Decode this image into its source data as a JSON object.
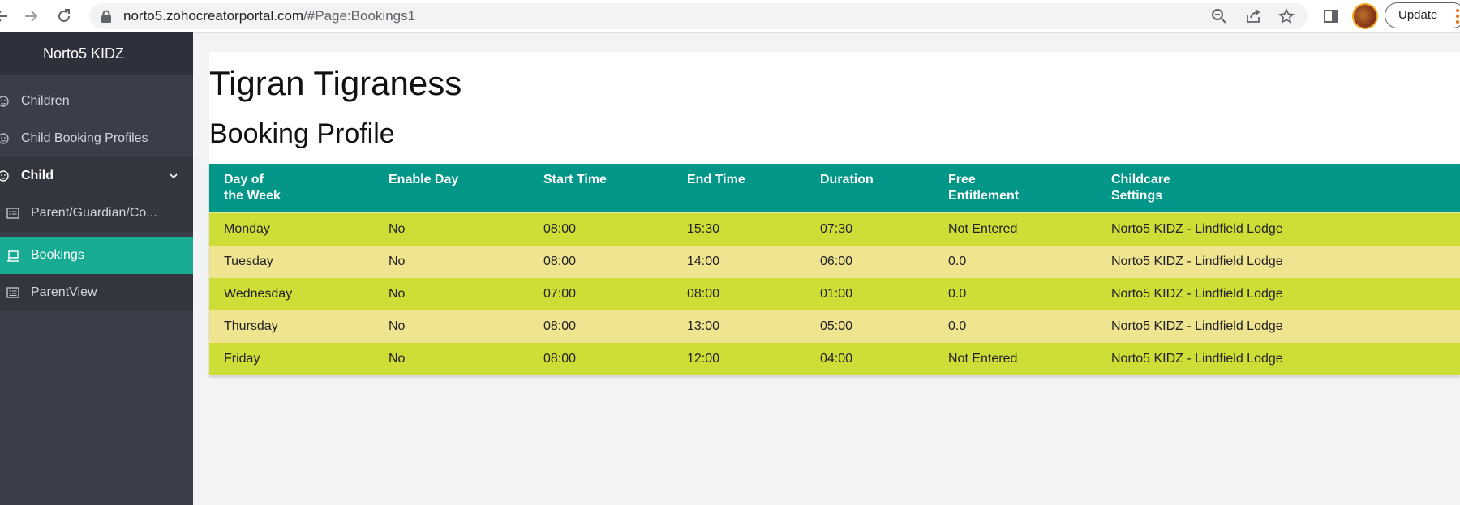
{
  "browser": {
    "url_host": "norto5.zohocreatorportal.com",
    "url_path": "/#Page:Bookings1",
    "update_label": "Update"
  },
  "sidebar": {
    "app_title": "Norto5 KIDZ",
    "items": [
      {
        "label": "Children",
        "icon": "child-face-icon"
      },
      {
        "label": "Child Booking Profiles",
        "icon": "child-face-icon"
      },
      {
        "label": "Child",
        "icon": "child-face-icon",
        "expanded": true
      },
      {
        "label": "Parent/Guardian/Co...",
        "icon": "form-list-icon"
      },
      {
        "label": "Bookings",
        "icon": "booking-page-icon",
        "active": true
      },
      {
        "label": "ParentView",
        "icon": "form-list-icon"
      }
    ]
  },
  "main": {
    "person_name": "Tigran Tigraness",
    "section_title": "Booking Profile",
    "table": {
      "columns": [
        [
          "Day of",
          "the Week"
        ],
        [
          "Enable Day"
        ],
        [
          "Start Time"
        ],
        [
          "End Time"
        ],
        [
          "Duration"
        ],
        [
          "Free",
          "Entitlement"
        ],
        [
          "Childcare",
          "Settings"
        ]
      ],
      "rows": [
        [
          "Monday",
          "No",
          "08:00",
          "15:30",
          "07:30",
          "Not Entered",
          "Norto5 KIDZ - Lindfield Lodge"
        ],
        [
          "Tuesday",
          "No",
          "08:00",
          "14:00",
          "06:00",
          "0.0",
          "Norto5 KIDZ - Lindfield Lodge"
        ],
        [
          "Wednesday",
          "No",
          "07:00",
          "08:00",
          "01:00",
          "0.0",
          "Norto5 KIDZ - Lindfield Lodge"
        ],
        [
          "Thursday",
          "No",
          "08:00",
          "13:00",
          "05:00",
          "0.0",
          "Norto5 KIDZ - Lindfield Lodge"
        ],
        [
          "Friday",
          "No",
          "08:00",
          "12:00",
          "04:00",
          "Not Entered",
          "Norto5 KIDZ - Lindfield Lodge"
        ]
      ]
    }
  },
  "colors": {
    "table_header": "#019687",
    "row_odd": "#cfdd37",
    "row_even": "#efe48f",
    "sidebar_active": "#17ab93",
    "sidebar_bg": "#3a3d4a"
  }
}
